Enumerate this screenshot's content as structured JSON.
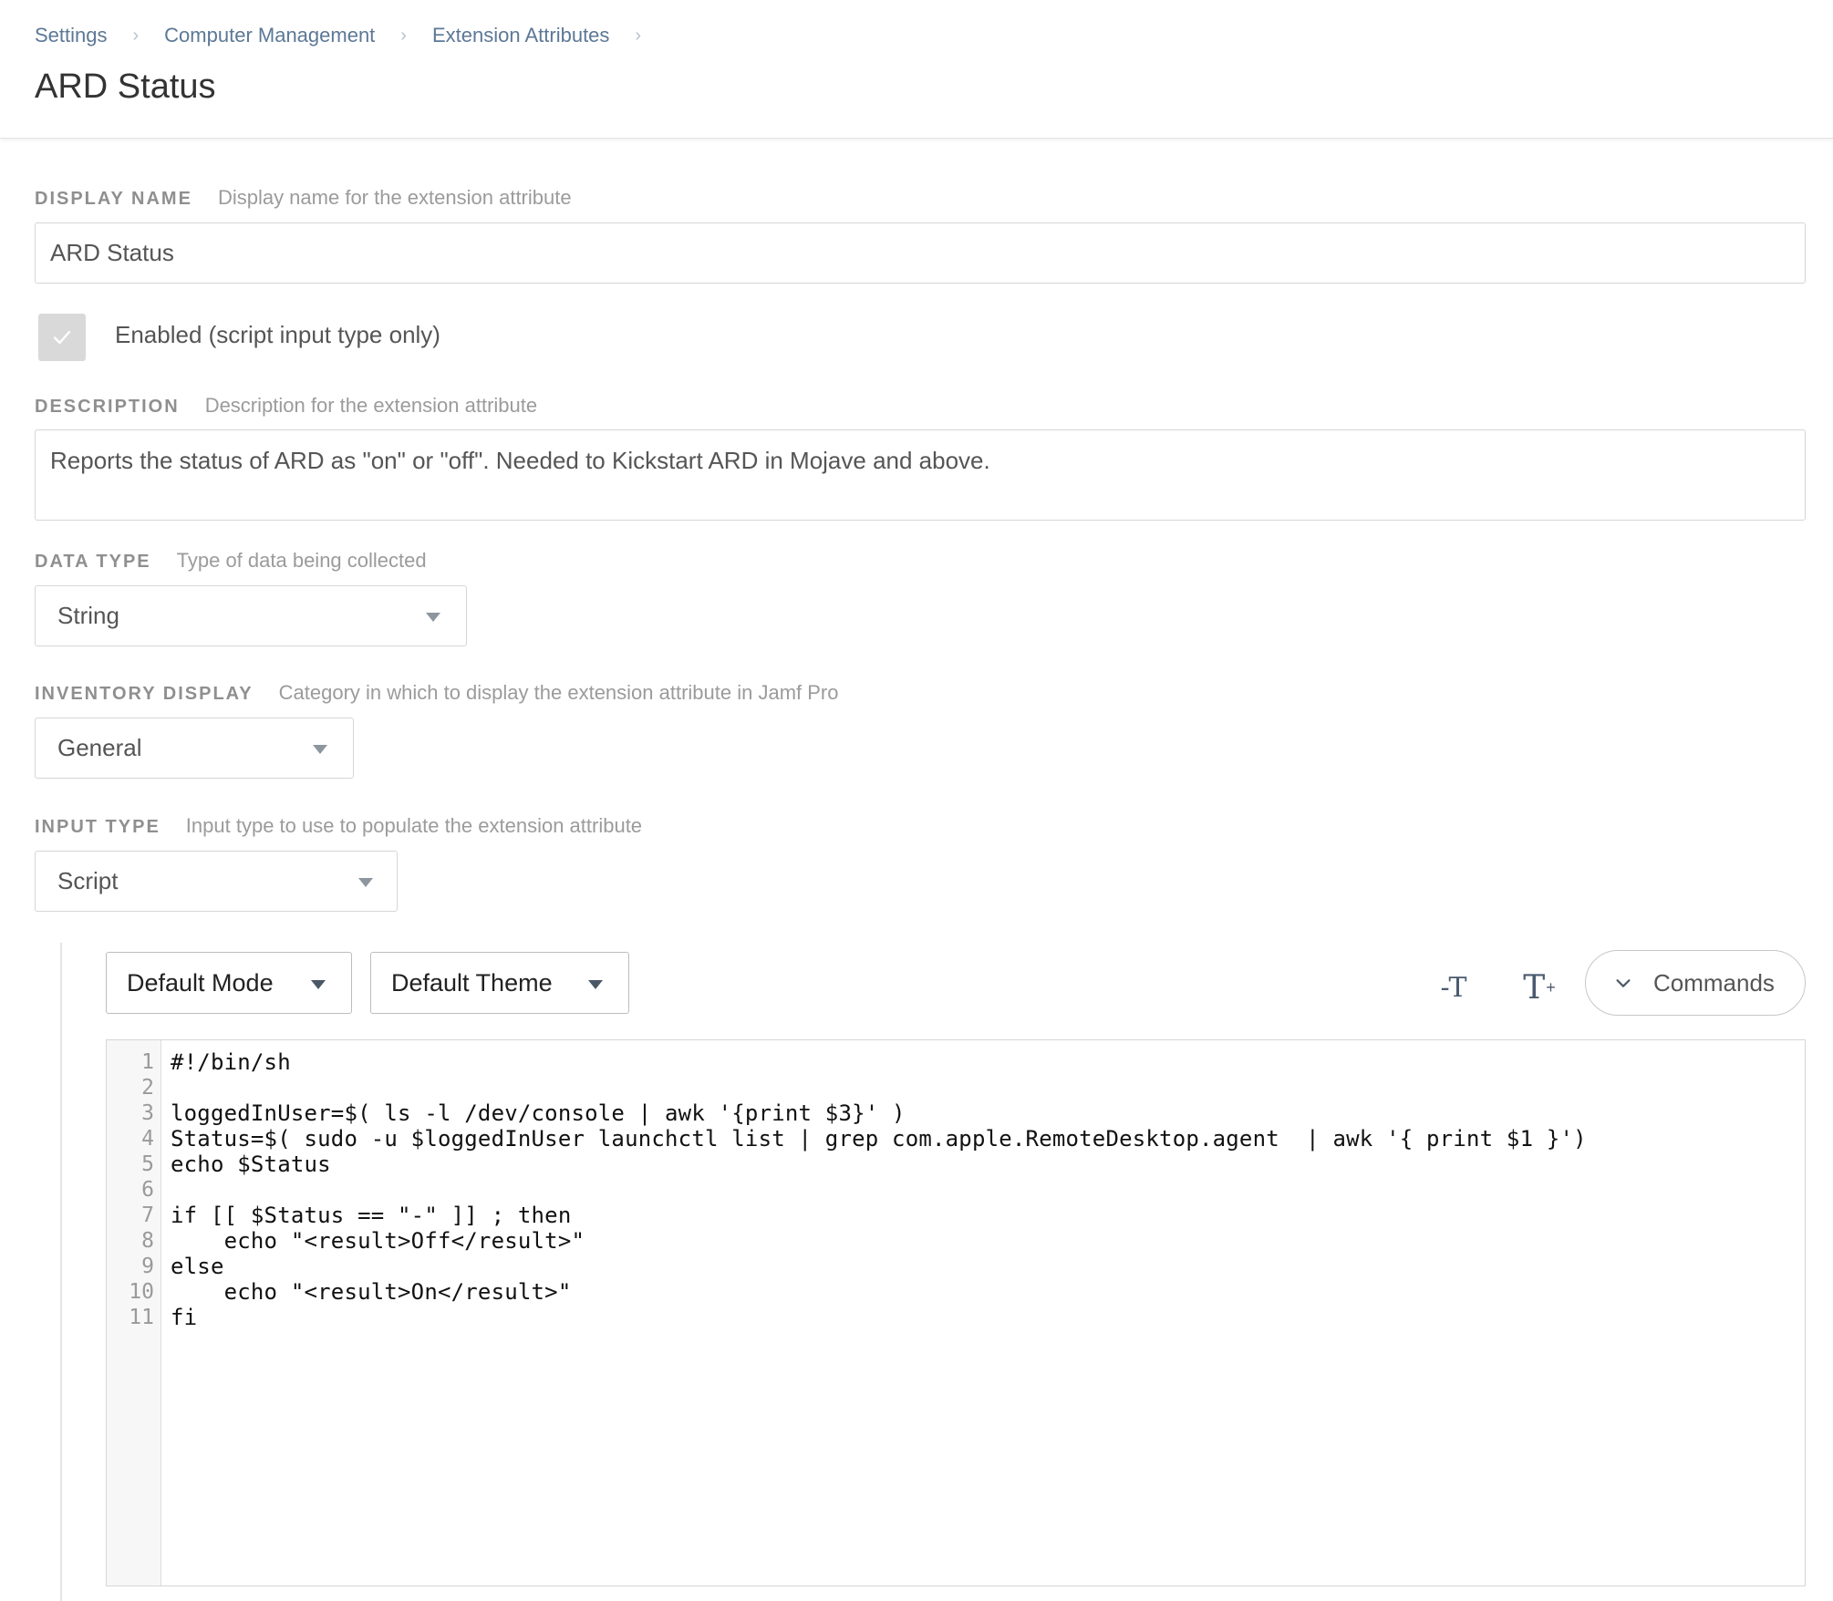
{
  "breadcrumb": {
    "items": [
      "Settings",
      "Computer Management",
      "Extension Attributes"
    ],
    "separator": "›"
  },
  "page": {
    "title": "ARD Status"
  },
  "display_name": {
    "label": "DISPLAY NAME",
    "hint": "Display name for the extension attribute",
    "value": "ARD Status"
  },
  "enabled": {
    "label": "Enabled (script input type only)",
    "checked": true
  },
  "description": {
    "label": "DESCRIPTION",
    "hint": "Description for the extension attribute",
    "value": "Reports the status of ARD as \"on\" or \"off\". Needed to Kickstart ARD in Mojave and above."
  },
  "data_type": {
    "label": "DATA TYPE",
    "hint": "Type of data being collected",
    "value": "String"
  },
  "inventory_display": {
    "label": "INVENTORY DISPLAY",
    "hint": "Category in which to display the extension attribute in Jamf Pro",
    "value": "General"
  },
  "input_type": {
    "label": "INPUT TYPE",
    "hint": "Input type to use to populate the extension attribute",
    "value": "Script"
  },
  "editor": {
    "mode": "Default Mode",
    "theme": "Default Theme",
    "font_decrease_label": "-T",
    "font_increase_label": "T",
    "font_increase_sup": "+",
    "commands_label": "Commands",
    "lines": [
      "#!/bin/sh",
      "",
      "loggedInUser=$( ls -l /dev/console | awk '{print $3}' )",
      "Status=$( sudo -u $loggedInUser launchctl list | grep com.apple.RemoteDesktop.agent  | awk '{ print $1 }')",
      "echo $Status",
      "",
      "if [[ $Status == \"-\" ]] ; then",
      "    echo \"<result>Off</result>\"",
      "else",
      "    echo \"<result>On</result>\"",
      "fi"
    ]
  },
  "colors": {
    "link": "#5c7896",
    "label": "#8f8f8f",
    "checkbox_bg": "#d9d9d9"
  }
}
